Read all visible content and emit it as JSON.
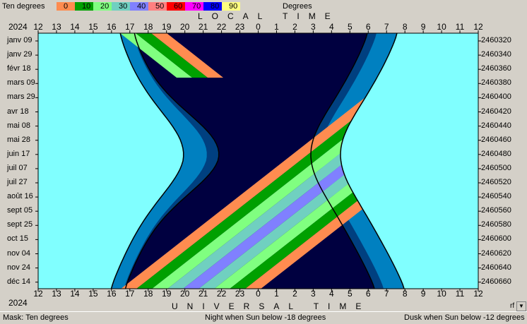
{
  "legend": {
    "title": "Ten degrees",
    "unit": "Degrees",
    "bands": [
      {
        "value": "0",
        "color": "#ff8c50"
      },
      {
        "value": "10",
        "color": "#00a000"
      },
      {
        "value": "20",
        "color": "#80ff80"
      },
      {
        "value": "30",
        "color": "#70d0c0"
      },
      {
        "value": "40",
        "color": "#8080ff"
      },
      {
        "value": "50",
        "color": "#ff8080"
      },
      {
        "value": "60",
        "color": "#ff0000"
      },
      {
        "value": "70",
        "color": "#ff00ff"
      },
      {
        "value": "80",
        "color": "#0000ff"
      },
      {
        "value": "90",
        "color": "#ffff80"
      }
    ]
  },
  "chart": {
    "year_top": "2024",
    "year_bottom": "2024",
    "top_axis_title": "LOCAL  TIME",
    "bottom_axis_title": "UNIVERSAL  TIME",
    "hours": [
      "12",
      "13",
      "14",
      "15",
      "16",
      "17",
      "18",
      "19",
      "20",
      "21",
      "22",
      "23",
      "0",
      "1",
      "2",
      "3",
      "4",
      "5",
      "6",
      "7",
      "8",
      "9",
      "10",
      "11",
      "12"
    ],
    "dates": [
      "janv 09",
      "janv 29",
      "févr 18",
      "mars 09",
      "mars 29",
      "avr 18",
      "mai 08",
      "mai 28",
      "juin 17",
      "juil 07",
      "juil 27",
      "août 16",
      "sept 05",
      "sept 25",
      "oct 15",
      "nov 04",
      "nov 24",
      "déc 14"
    ],
    "julian_days": [
      "2460320",
      "2460340",
      "2460360",
      "2460380",
      "2460400",
      "2460420",
      "2460440",
      "2460460",
      "2460480",
      "2460500",
      "2460520",
      "2460540",
      "2460560",
      "2460580",
      "2460600",
      "2460620",
      "2460640",
      "2460660"
    ],
    "colors": {
      "day": "#80ffff",
      "night": "#000040",
      "dusk_light": "#0080c0",
      "dusk_dark": "#004080"
    },
    "corner_label": "rf"
  },
  "status": {
    "mask": "Mask:  Ten degrees",
    "night": "Night when Sun below -18 degrees",
    "dusk": "Dusk when Sun below -12 degrees"
  }
}
